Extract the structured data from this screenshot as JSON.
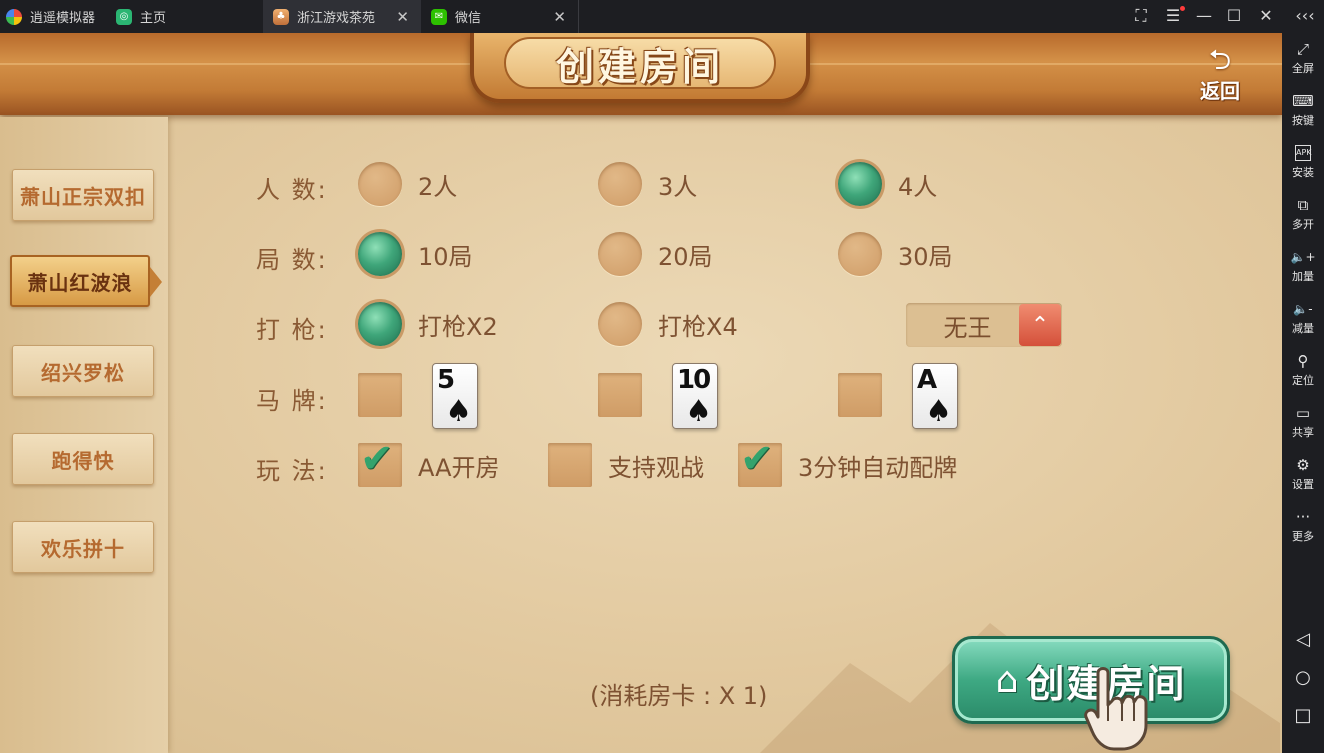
{
  "titlebar": {
    "app_name": "逍遥模拟器",
    "tabs": [
      {
        "label": "主页",
        "icon": "home-icon"
      },
      {
        "label": "浙江游戏茶苑",
        "icon": "game-icon"
      },
      {
        "label": "微信",
        "icon": "wechat-icon"
      }
    ],
    "close_glyph": "✕",
    "controls": {
      "fullscreen": "⛶",
      "menu": "☰",
      "minimize": "—",
      "maximize": "☐",
      "close": "✕",
      "collapse": "‹‹‹"
    }
  },
  "sidebar": {
    "items": [
      {
        "label": "全屏",
        "icon": "expand-icon",
        "glyph": "⤢"
      },
      {
        "label": "按键",
        "icon": "keyboard-icon",
        "glyph": "⌨"
      },
      {
        "label": "安装",
        "icon": "apk-icon",
        "glyph": "APK"
      },
      {
        "label": "多开",
        "icon": "multi-window-icon",
        "glyph": "⧉"
      },
      {
        "label": "加量",
        "icon": "volume-up-icon",
        "glyph": "🔈+"
      },
      {
        "label": "减量",
        "icon": "volume-down-icon",
        "glyph": "🔈-"
      },
      {
        "label": "定位",
        "icon": "location-icon",
        "glyph": "⚲"
      },
      {
        "label": "共享",
        "icon": "folder-icon",
        "glyph": "▭"
      },
      {
        "label": "设置",
        "icon": "gear-icon",
        "glyph": "⚙"
      },
      {
        "label": "更多",
        "icon": "more-icon",
        "glyph": "···"
      }
    ],
    "nav": {
      "back": "◁",
      "home": "○",
      "recents": "□"
    }
  },
  "game": {
    "title": "创建房间",
    "back_label": "返回",
    "back_icon": "back-arrow-icon",
    "modes": [
      {
        "label": "萧山正宗双扣",
        "active": false
      },
      {
        "label": "萧山红波浪",
        "active": true
      },
      {
        "label": "绍兴罗松",
        "active": false
      },
      {
        "label": "跑得快",
        "active": false
      },
      {
        "label": "欢乐拼十",
        "active": false
      }
    ],
    "rows": {
      "players": {
        "label": "人  数:",
        "options": [
          {
            "label": "2人",
            "selected": false
          },
          {
            "label": "3人",
            "selected": false
          },
          {
            "label": "4人",
            "selected": true
          }
        ]
      },
      "rounds": {
        "label": "局  数:",
        "options": [
          {
            "label": "10局",
            "selected": true
          },
          {
            "label": "20局",
            "selected": false
          },
          {
            "label": "30局",
            "selected": false
          }
        ]
      },
      "gun": {
        "label": "打  枪:",
        "options": [
          {
            "label": "打枪X2",
            "selected": true
          },
          {
            "label": "打枪X4",
            "selected": false
          }
        ],
        "select_value": "无王",
        "select_arrow": "⌃"
      },
      "horse": {
        "label": "马  牌:",
        "cards": [
          {
            "rank": "5",
            "suit": "♠",
            "checked": false
          },
          {
            "rank": "10",
            "suit": "♠",
            "checked": false
          },
          {
            "rank": "A",
            "suit": "♠",
            "checked": false
          }
        ]
      },
      "rules": {
        "label": "玩  法:",
        "options": [
          {
            "label": "AA开房",
            "checked": true
          },
          {
            "label": "支持观战",
            "checked": false
          },
          {
            "label": "3分钟自动配牌",
            "checked": true
          }
        ],
        "tick": "✔"
      }
    },
    "cost_text": "(消耗房卡 : X 1)",
    "create_button": {
      "label": "创建房间",
      "icon": "house-icon",
      "glyph": "⌂"
    }
  },
  "colors": {
    "accent_green": "#3ea983",
    "brown_text": "#7e5232",
    "header_orange": "#d49148"
  }
}
